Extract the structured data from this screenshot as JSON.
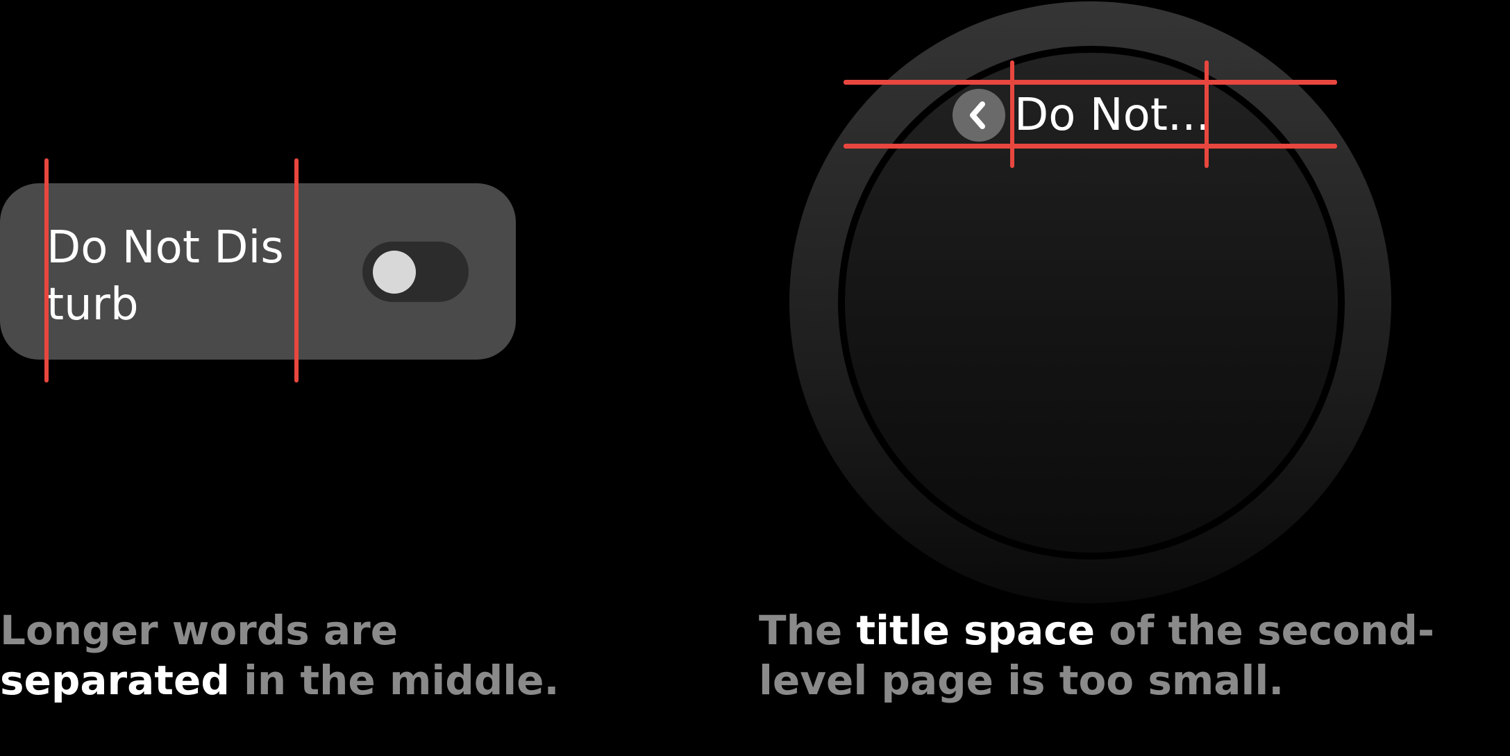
{
  "list_card": {
    "label": "Do Not Disturb",
    "toggle_state": "off"
  },
  "watch": {
    "back_icon": "chevron-left-icon",
    "title": "Do Not..."
  },
  "annotation_color": "#e8473f",
  "captions": {
    "left": {
      "line1": "Longer words are",
      "line2_emphasis": "separated",
      "line2_rest": " in the middle."
    },
    "right": {
      "line1_start": "The ",
      "line1_emphasis": "title space",
      "line1_rest": " of the second-",
      "line2": "level page is too small."
    }
  }
}
